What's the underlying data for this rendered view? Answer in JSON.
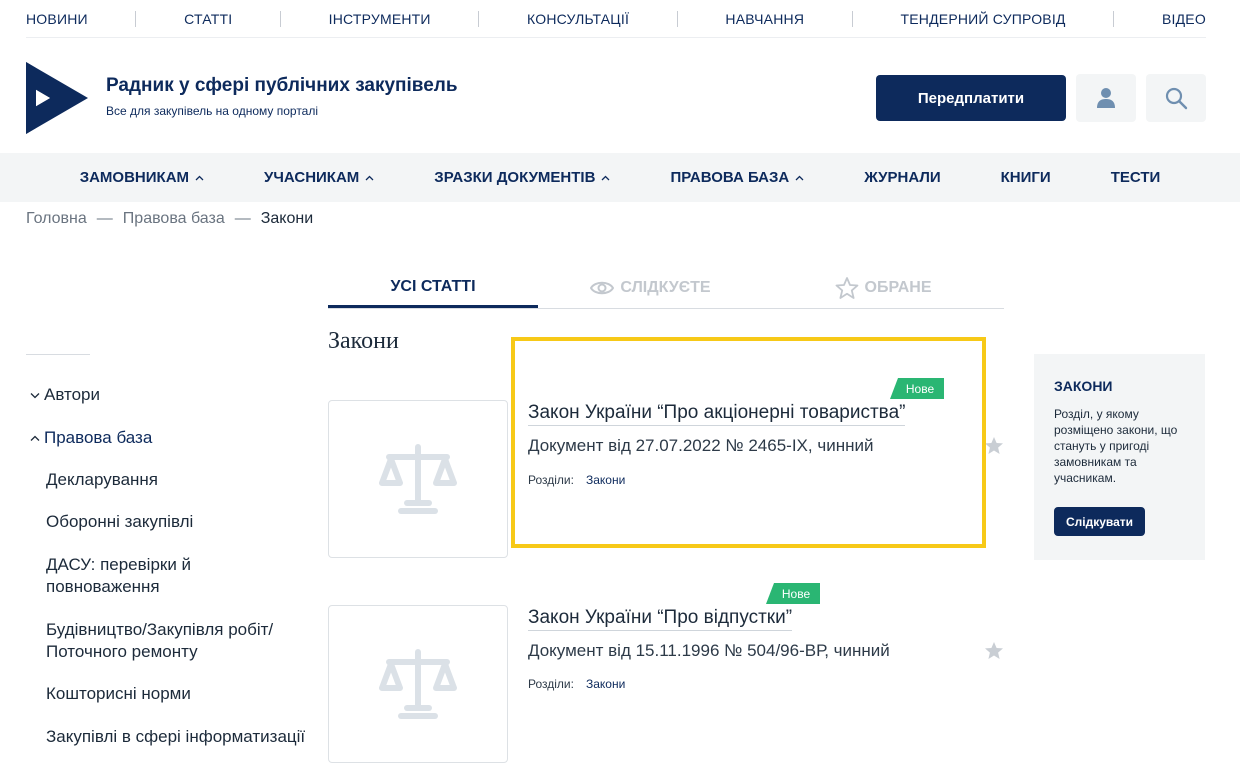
{
  "topnav": {
    "items": [
      "НОВИНИ",
      "СТАТТІ",
      "ІНСТРУМЕНТИ",
      "КОНСУЛЬТАЦІЇ",
      "НАВЧАННЯ",
      "ТЕНДЕРНИЙ СУПРОВІД",
      "ВІДЕО"
    ]
  },
  "header": {
    "title": "Радник у сфері публічних закупівель",
    "subtitle": "Все для закупівель на одному порталі",
    "subscribe_label": "Передплатити"
  },
  "mainnav": {
    "items": [
      {
        "label": "ЗАМОВНИКАМ"
      },
      {
        "label": "УЧАСНИКАМ"
      },
      {
        "label": "ЗРАЗКИ ДОКУМЕНТІВ"
      },
      {
        "label": "ПРАВОВА БАЗА"
      },
      {
        "label": "ЖУРНАЛИ"
      },
      {
        "label": "КНИГИ"
      },
      {
        "label": "ТЕСТИ"
      }
    ]
  },
  "breadcrumb": {
    "items": [
      "Головна",
      "Правова база",
      "Закони"
    ],
    "separator": "—"
  },
  "tabs": {
    "all": "УСІ СТАТТІ",
    "following": "СЛІДКУЄТЕ",
    "favorites": "ОБРАНЕ"
  },
  "section_title": "Закони",
  "sidebar": {
    "authors": "Автори",
    "legal_base": "Правова база",
    "subitems": [
      "Декларування",
      "Оборонні закупівлі",
      "ДАСУ: перевірки й повноваження",
      "Будівництво/Закупівля робіт/ Поточного ремонту",
      "Кошторисні норми",
      "Закупівлі в сфері інформатизації"
    ]
  },
  "articles": [
    {
      "badge": "Нове",
      "title": "Закон України “Про акціонерні товариства”",
      "meta": "Документ від 27.07.2022 № 2465-IX, чинний",
      "sections_label": "Розділи:",
      "section_link": "Закони"
    },
    {
      "badge": "Нове",
      "title": "Закон України “Про відпустки”",
      "meta": "Документ від 15.11.1996 № 504/96-ВР, чинний",
      "sections_label": "Розділи:",
      "section_link": "Закони"
    }
  ],
  "widget": {
    "title": "ЗАКОНИ",
    "description": "Розділ, у якому розміщено закони, що стануть у пригоді замовникам та учасникам.",
    "button": "Слідкувати"
  },
  "colors": {
    "brand": "#0d2a5c",
    "badge": "#2ab673",
    "highlight": "#f7c917",
    "panel": "#f3f5f6"
  }
}
